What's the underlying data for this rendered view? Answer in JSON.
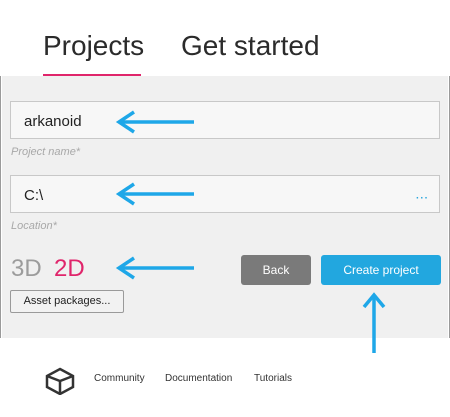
{
  "tabs": {
    "projects": "Projects",
    "get_started": "Get started"
  },
  "form": {
    "project_name_value": "arkanoid",
    "project_name_caption": "Project name*",
    "location_value": "C:\\",
    "location_caption": "Location*",
    "location_browse": "···"
  },
  "mode": {
    "three_d": "3D",
    "two_d": "2D"
  },
  "buttons": {
    "back": "Back",
    "create": "Create project",
    "asset_packages": "Asset packages..."
  },
  "footer": {
    "community": "Community",
    "documentation": "Documentation",
    "tutorials": "Tutorials"
  },
  "colors": {
    "accent_pink": "#e0256b",
    "accent_blue": "#22a7df",
    "annotation_arrow": "#1ea7e8"
  },
  "icons": {
    "logo": "unity-logo-icon",
    "annotation": "arrow-icon"
  }
}
